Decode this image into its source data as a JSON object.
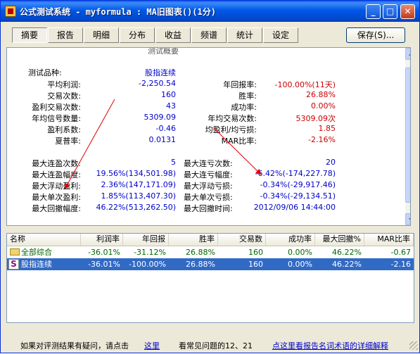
{
  "window": {
    "title": "公式测试系统 - myformula : MA旧图表()(1分)",
    "controls": {
      "minimize": "_",
      "maximize": "□",
      "close": "✕"
    }
  },
  "tabs": [
    {
      "label": "摘要",
      "active": true
    },
    {
      "label": "报告",
      "active": false
    },
    {
      "label": "明细",
      "active": false
    },
    {
      "label": "分布",
      "active": false
    },
    {
      "label": "收益",
      "active": false
    },
    {
      "label": "频谱",
      "active": false
    },
    {
      "label": "统计",
      "active": false
    },
    {
      "label": "设定",
      "active": false
    }
  ],
  "save_button": {
    "label": "保存(S)..."
  },
  "summary": {
    "cut_heading": "测试概要",
    "left_block_1": [
      {
        "label": "测试品种:",
        "value": "股指连续",
        "color": "blue"
      },
      {
        "label": "平均利润:",
        "value": "-2,250.54",
        "color": "blue"
      },
      {
        "label": "交易次数:",
        "value": "160",
        "color": "blue"
      },
      {
        "label": "盈利交易次数:",
        "value": "43",
        "color": "blue"
      },
      {
        "label": "年均信号数量:",
        "value": "5309.09",
        "color": "blue"
      },
      {
        "label": "盈利系数:",
        "value": "-0.46",
        "color": "blue"
      },
      {
        "label": "夏普率:",
        "value": "0.0131",
        "color": "blue"
      }
    ],
    "right_block_1": [
      {
        "label": "年回报率:",
        "value": "-100.00%(11天)",
        "color": "red"
      },
      {
        "label": "胜率:",
        "value": "26.88%",
        "color": "red"
      },
      {
        "label": "成功率:",
        "value": "0.00%",
        "color": "red"
      },
      {
        "label": "年均交易次数:",
        "value": "5309.09次",
        "color": "red"
      },
      {
        "label": "均盈利/均亏损:",
        "value": "1.85",
        "color": "red"
      },
      {
        "label": "MAR比率:",
        "value": "-2.16%",
        "color": "red"
      }
    ],
    "left_block_2": [
      {
        "label": "最大连盈次数:",
        "value": "5"
      },
      {
        "label": "最大连盈幅度:",
        "value": "19.56%(134,501.98)"
      },
      {
        "label": "最大浮动盈利:",
        "value": "2.36%(147,171.09)"
      },
      {
        "label": "最大单次盈利:",
        "value": "1.85%(113,407.30)"
      },
      {
        "label": "最大回撤幅度:",
        "value": "46.22%(513,262.50)"
      }
    ],
    "right_block_2": [
      {
        "label": "最大连亏次数:",
        "value": "20"
      },
      {
        "label": "最大连亏幅度:",
        "value": "-6.42%(-174,227.78)"
      },
      {
        "label": "最大浮动亏损:",
        "value": "-0.34%(-29,917.46)"
      },
      {
        "label": "最大单次亏损:",
        "value": "-0.34%(-29,134.51)"
      },
      {
        "label": "最大回撤时间:",
        "value": "2012/09/06 14:44:00"
      }
    ]
  },
  "table": {
    "columns": [
      "名称",
      "利润率",
      "年回报",
      "胜率",
      "交易数",
      "成功率",
      "最大回撤%",
      "MAR比率"
    ],
    "rows": [
      {
        "name": "全部综合",
        "icon": "folder-icon",
        "values": [
          "-36.01%",
          "-31.12%",
          "26.88%",
          "160",
          "0.00%",
          "46.22%",
          "-0.67"
        ],
        "selected": false
      },
      {
        "name": "股指连续",
        "icon": "s-icon",
        "icon_letter": "S",
        "values": [
          "-36.01%",
          "-100.00%",
          "26.88%",
          "160",
          "0.00%",
          "46.22%",
          "-2.16"
        ],
        "selected": true
      }
    ]
  },
  "footer": {
    "question_text": "如果对评测结果有疑问，请点击",
    "here_link": "这里",
    "faq_text": "看常见问题的12、21",
    "glossary_link": "点这里看报告名词术语的详细解释"
  },
  "colors": {
    "title_bar": "#0058e6",
    "selection": "#316ac5",
    "value_blue": "#0000cc",
    "value_red": "#cc0000",
    "annotation_arrow": "#e00000"
  }
}
